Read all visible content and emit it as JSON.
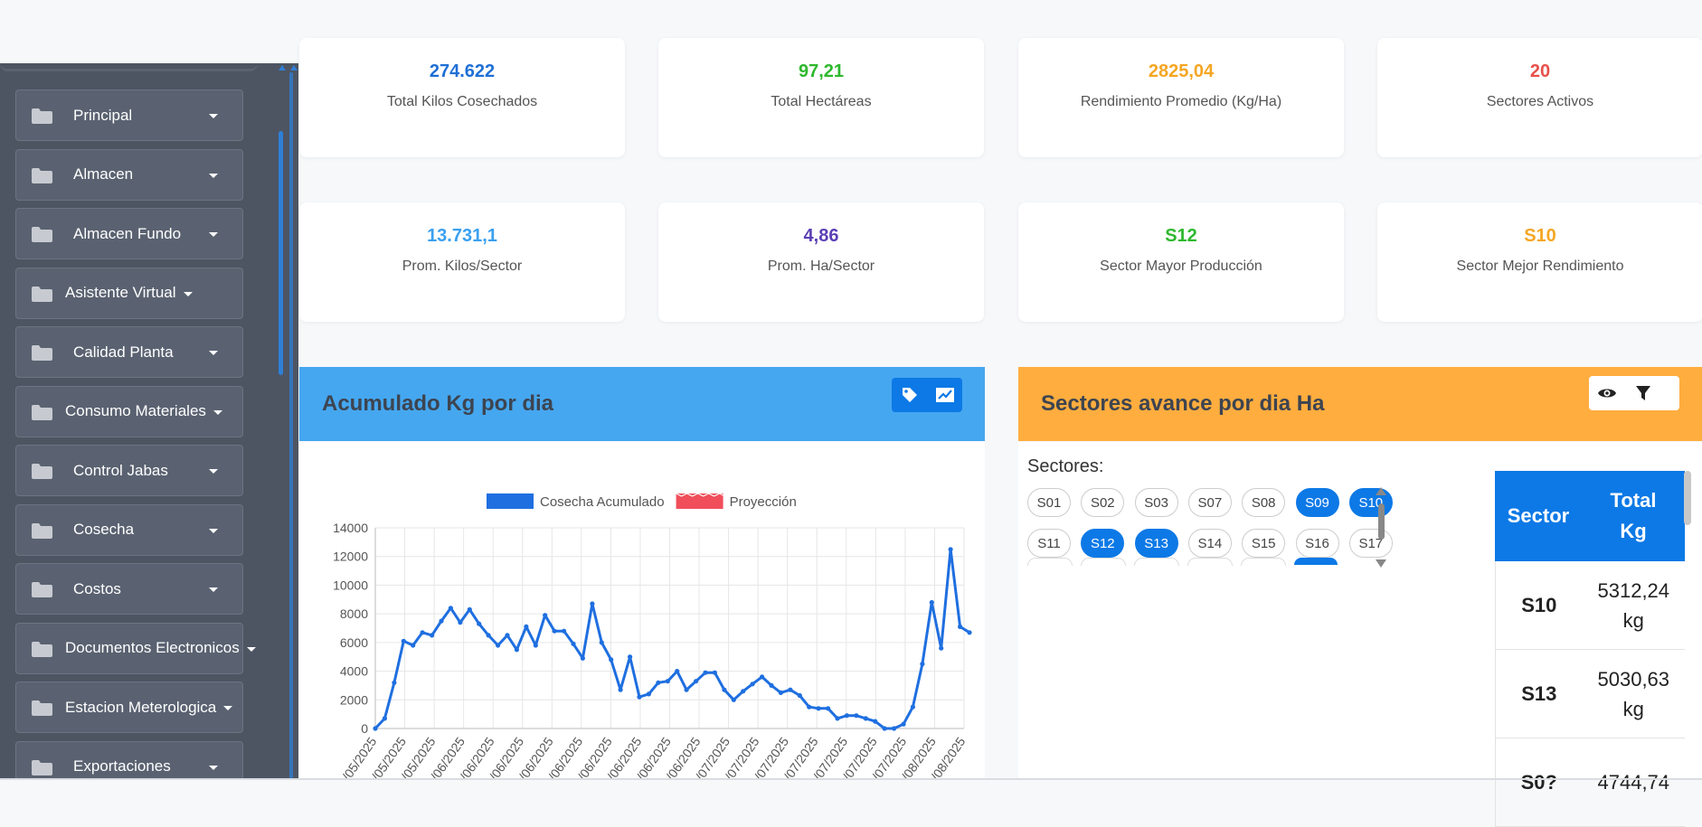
{
  "sidebar": {
    "items": [
      {
        "label": "Principal"
      },
      {
        "label": "Almacen"
      },
      {
        "label": "Almacen Fundo"
      },
      {
        "label": "Asistente Virtual"
      },
      {
        "label": "Calidad Planta"
      },
      {
        "label": "Consumo Materiales"
      },
      {
        "label": "Control Jabas"
      },
      {
        "label": "Cosecha"
      },
      {
        "label": "Costos"
      },
      {
        "label": "Documentos Electronicos"
      },
      {
        "label": "Estacion Meterologica"
      },
      {
        "label": "Exportaciones"
      }
    ]
  },
  "kpis": [
    {
      "value": "274.622",
      "caption": "Total Kilos Cosechados",
      "color": "#1f6fd6"
    },
    {
      "value": "97,21",
      "caption": "Total Hectáreas",
      "color": "#2eb82e"
    },
    {
      "value": "2825,04",
      "caption": "Rendimiento Promedio (Kg/Ha)",
      "color": "#f5a623"
    },
    {
      "value": "20",
      "caption": "Sectores Activos",
      "color": "#e8504a"
    },
    {
      "value": "13.731,1",
      "caption": "Prom. Kilos/Sector",
      "color": "#3aa0f0"
    },
    {
      "value": "4,86",
      "caption": "Prom. Ha/Sector",
      "color": "#5b3fb5"
    },
    {
      "value": "S12",
      "caption": "Sector Mayor Producción",
      "color": "#2eb82e"
    },
    {
      "value": "S10",
      "caption": "Sector Mejor Rendimiento",
      "color": "#f5a623"
    }
  ],
  "chart_panel": {
    "title": "Acumulado Kg por dia",
    "header_color": "#45a7f0",
    "icons": [
      "tag-icon",
      "chart-line-icon"
    ]
  },
  "sector_panel": {
    "title": "Sectores avance por dia Ha",
    "header_color": "#ffad3f",
    "icons": [
      "eye-icon",
      "filter-icon"
    ],
    "label": "Sectores:",
    "chips": [
      {
        "label": "S01",
        "selected": false
      },
      {
        "label": "S02",
        "selected": false
      },
      {
        "label": "S03",
        "selected": false
      },
      {
        "label": "S07",
        "selected": false
      },
      {
        "label": "S08",
        "selected": false
      },
      {
        "label": "S09",
        "selected": true
      },
      {
        "label": "S10",
        "selected": true
      },
      {
        "label": "S11",
        "selected": false
      },
      {
        "label": "S12",
        "selected": true
      },
      {
        "label": "S13",
        "selected": true
      },
      {
        "label": "S14",
        "selected": false
      },
      {
        "label": "S15",
        "selected": false
      },
      {
        "label": "S16",
        "selected": false
      },
      {
        "label": "S17",
        "selected": false
      }
    ],
    "table": {
      "headers": [
        "Sector",
        "Total Kg"
      ],
      "rows": [
        {
          "sector": "S10",
          "total": "5312,24",
          "unit": "kg"
        },
        {
          "sector": "S13",
          "total": "5030,63",
          "unit": "kg"
        },
        {
          "sector": "S0?",
          "total": "4744,74",
          "unit": ""
        }
      ]
    }
  },
  "chart_data": {
    "type": "line",
    "title": "",
    "xlabel": "",
    "ylabel": "",
    "ylim": [
      0,
      14000
    ],
    "yticks": [
      0,
      2000,
      4000,
      6000,
      8000,
      10000,
      12000,
      14000
    ],
    "xtick_labels": [
      "/05/2025",
      "/05/2025",
      "/05/2025",
      "/06/2025",
      "/06/2025",
      "/06/2025",
      "/06/2025",
      "/06/2025",
      "/06/2025",
      "/06/2025",
      "/06/2025",
      "/06/2025",
      "/07/2025",
      "/07/2025",
      "/07/2025",
      "/07/2025",
      "/07/2025",
      "/07/2025",
      "/07/2025",
      "/08/2025",
      "/08/2025"
    ],
    "legend": [
      {
        "name": "Cosecha Acumulado",
        "color": "#1f6fe0",
        "dashed": false
      },
      {
        "name": "Proyección",
        "color": "#f04e5a",
        "dashed": true
      }
    ],
    "series": [
      {
        "name": "Cosecha Acumulado",
        "color": "#1f6fe0",
        "values": [
          0,
          700,
          3200,
          6100,
          5800,
          6700,
          6500,
          7500,
          8400,
          7400,
          8300,
          7300,
          6500,
          5800,
          6500,
          5500,
          7100,
          5800,
          7900,
          6800,
          6800,
          5900,
          4900,
          8700,
          6000,
          4800,
          2700,
          5000,
          2200,
          2400,
          3200,
          3300,
          4000,
          2700,
          3300,
          3900,
          3900,
          2700,
          2000,
          2600,
          3100,
          3600,
          3000,
          2500,
          2700,
          2300,
          1500,
          1400,
          1400,
          700,
          900,
          900,
          700,
          500,
          0,
          0,
          300,
          1500,
          4500,
          8800,
          5600,
          12500,
          7100,
          6700
        ]
      }
    ]
  }
}
